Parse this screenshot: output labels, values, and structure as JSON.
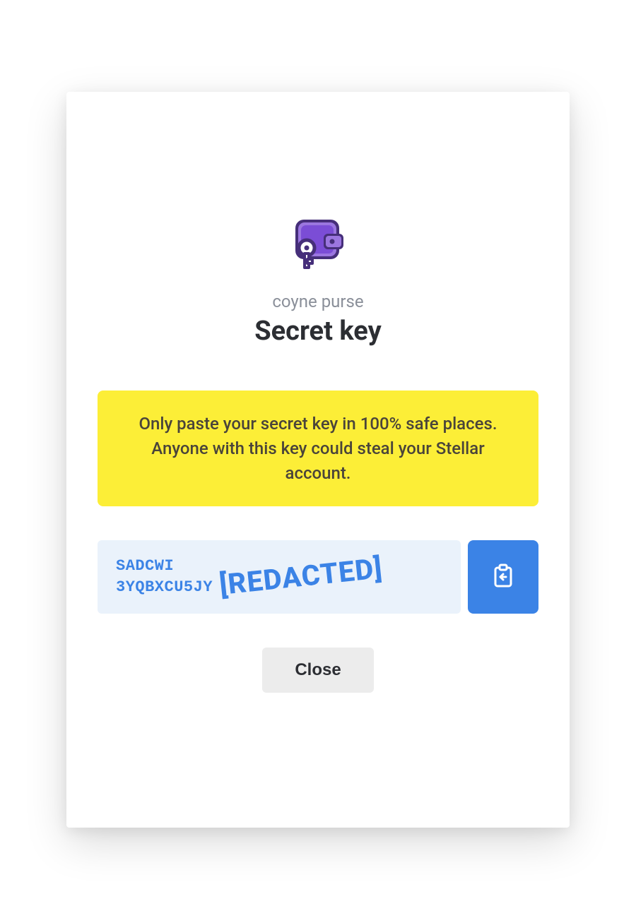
{
  "header": {
    "subtitle": "coyne purse",
    "title": "Secret key"
  },
  "warning": {
    "text": "Only paste your secret key in 100% safe places. Anyone with this key could steal your Stellar account."
  },
  "key": {
    "line1": "SADCWI",
    "line2": "3YQBXCU5JY",
    "redacted_label": "[REDACTED]"
  },
  "buttons": {
    "close_label": "Close"
  },
  "colors": {
    "accent": "#3b83e6",
    "warning_bg": "#fcee37",
    "key_bg": "#eaf2fb",
    "wallet_purple": "#7b4dd6",
    "wallet_purple_light": "#9b76e0"
  },
  "icons": {
    "wallet": "wallet-key-icon",
    "copy": "clipboard-paste-icon"
  }
}
